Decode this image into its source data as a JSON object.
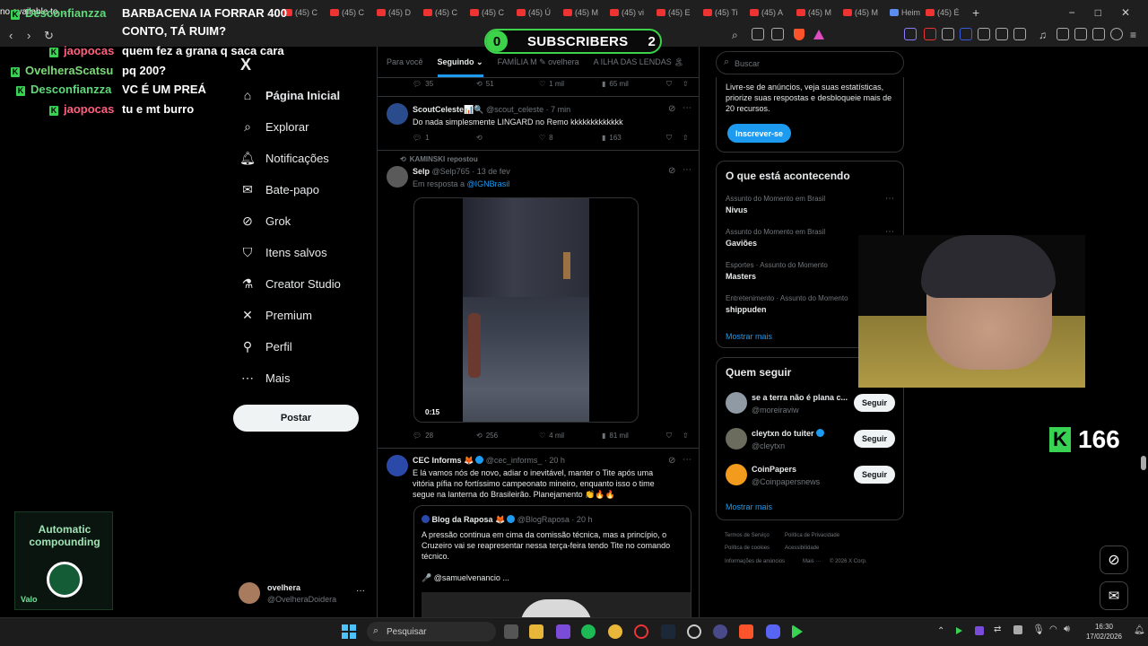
{
  "browser": {
    "tabs": [
      "(45) C",
      "(45) C",
      "(45) D",
      "(45) C",
      "(45) C",
      "(45) Ú",
      "(45) M",
      "(45) vi",
      "(45) E",
      "(45) Ti",
      "(45) A",
      "(45) M",
      "(45) M"
    ],
    "tab_heim": "Heim",
    "tab_last": "(45) É",
    "new_tab": "+",
    "win_min": "−",
    "win_max": "□",
    "win_close": "✕"
  },
  "overlay": {
    "subscribers_zero": "0",
    "subscribers_label": "SUBSCRIBERS",
    "subscribers_count": "2",
    "chat_top_fragment": "no available to... ",
    "chat": [
      {
        "user": "Desconfianzza",
        "message": "BARBACENA IA FORRAR 400"
      },
      {
        "user": "",
        "message": "CONTO, TÁ RUIM?"
      },
      {
        "user": "jaopocas",
        "message": "quem fez a grana q saca cara"
      },
      {
        "user": "OvelheraScatsu",
        "message": "pq 200?"
      },
      {
        "user": "Desconfianzza",
        "message": "VC É UM PREÁ"
      },
      {
        "user": "jaopocas",
        "message": "tu e mt burro"
      }
    ],
    "kick_count": "166",
    "kick_logo": "K",
    "promo_title": "Automatic compounding",
    "promo_brand": "Valo"
  },
  "sidebar": {
    "logo": "X",
    "items": [
      {
        "label": "Página Inicial",
        "icon": "home-icon"
      },
      {
        "label": "Explorar",
        "icon": "search-icon"
      },
      {
        "label": "Notificações",
        "icon": "bell-icon"
      },
      {
        "label": "Bate-papo",
        "icon": "mail-icon"
      },
      {
        "label": "Grok",
        "icon": "grok-icon"
      },
      {
        "label": "Itens salvos",
        "icon": "bookmark-icon"
      },
      {
        "label": "Creator Studio",
        "icon": "flask-icon"
      },
      {
        "label": "Premium",
        "icon": "x-icon"
      },
      {
        "label": "Perfil",
        "icon": "person-icon"
      },
      {
        "label": "Mais",
        "icon": "more-icon"
      }
    ],
    "post_label": "Postar",
    "profile_name": "ovelhera",
    "profile_handle": "@OvelheraDoidera",
    "profile_more": "···"
  },
  "feed": {
    "tabs": [
      "Para você",
      "Seguindo",
      "FAMÍLIA M",
      "ovelhera",
      "A ILHA DAS LENDAS"
    ],
    "tweets": [
      {
        "replies": "35",
        "retweets": "51",
        "likes": "1 mil",
        "views": "65 mil"
      },
      {
        "name": "ScoutCeleste",
        "handle": "@scout_celeste · 7 min",
        "text": "Do nada simplesmente LINGARD no Remo kkkkkkkkkkkkk",
        "replies": "1",
        "retweets": "",
        "likes": "8",
        "views": "163"
      },
      {
        "repost": "KAMINSKI repostou",
        "name": "Selp",
        "handle": "@Selp765 · 13 de fev",
        "reply_prefix": "Em resposta a",
        "reply_to": "@IGNBrasil",
        "video_time": "0:15",
        "replies": "28",
        "retweets": "256",
        "likes": "4 mil",
        "views": "81 mil"
      },
      {
        "name": "CEC Informs",
        "handle": "@cec_informs_ · 20 h",
        "text": "E lá vamos nós de novo, adiar o inevitável, manter o Tite após uma vitória pífia no fortíssimo campeonato mineiro, enquanto isso o time segue na lanterna do Brasileirão. Planejamento 👏🔥🔥"
      },
      {
        "name": "Blog da Raposa",
        "handle": "@BlogRaposa · 20 h",
        "text": "A pressão continua em cima da comissão técnica, mas a princípio, o Cruzeiro vai se reapresentar nessa terça-feira tendo Tite no comando técnico.",
        "mention": "🎤 @samuelvenancio ..."
      }
    ]
  },
  "right": {
    "search_placeholder": "Buscar",
    "premium_text": "Livre-se de anúncios, veja suas estatísticas, priorize suas respostas e desbloqueie mais de 20 recursos.",
    "subscribe_label": "Inscrever-se",
    "trends_title": "O que está acontecendo",
    "trends": [
      {
        "category": "Assunto do Momento em Brasil",
        "name": "Nivus"
      },
      {
        "category": "Assunto do Momento em Brasil",
        "name": "Gaviões"
      },
      {
        "category": "Esportes · Assunto do Momento",
        "name": "Masters"
      },
      {
        "category": "Entretenimento · Assunto do Momento",
        "name": "shippuden"
      }
    ],
    "show_more": "Mostrar mais",
    "follow_title": "Quem seguir",
    "follows": [
      {
        "name": "se a terra não é plana c...",
        "handle": "@moreiraviw"
      },
      {
        "name": "cleytxn do tuiter",
        "handle": "@cleytxn"
      },
      {
        "name": "CoinPapers",
        "handle": "@Coinpapersnews"
      }
    ],
    "follow_label": "Seguir",
    "footer": [
      "Termos de Serviço",
      "Política de Privacidade",
      "Política de cookies",
      "Acessibilidade",
      "Informações de anúncios",
      "Mais ···",
      "© 2026 X Corp."
    ]
  },
  "taskbar": {
    "search_placeholder": "Pesquisar",
    "time": "16:30",
    "date": "17/02/2026"
  }
}
